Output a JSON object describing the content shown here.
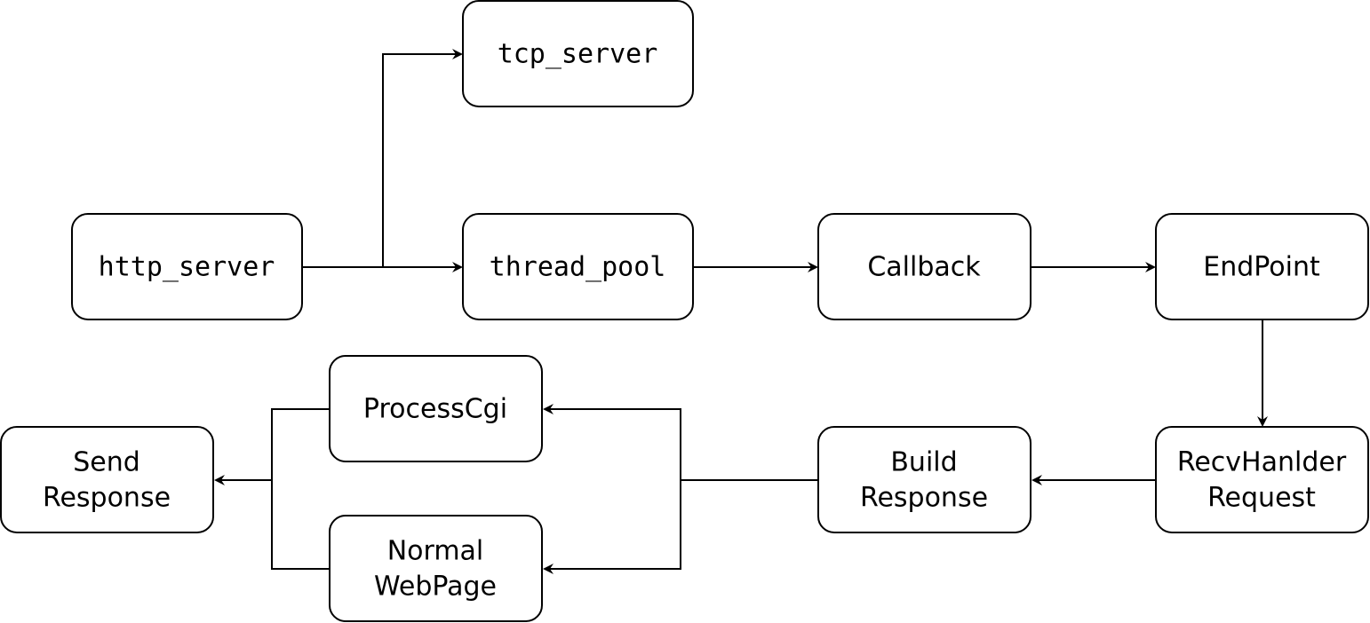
{
  "nodes": {
    "tcp_server": {
      "label": "tcp_server"
    },
    "http_server": {
      "label": "http_server"
    },
    "thread_pool": {
      "label": "thread_pool"
    },
    "callback": {
      "label": "Callback"
    },
    "endpoint": {
      "label": "EndPoint"
    },
    "recv_request": {
      "line1": "RecvHanlder",
      "line2": "Request"
    },
    "build_response": {
      "line1": "Build",
      "line2": "Response"
    },
    "process_cgi": {
      "label": "ProcessCgi"
    },
    "normal_webpage": {
      "line1": "Normal",
      "line2": "WebPage"
    },
    "send_response": {
      "line1": "Send",
      "line2": "Response"
    }
  },
  "edges": [
    {
      "from": "http_server",
      "to": "tcp_server"
    },
    {
      "from": "http_server",
      "to": "thread_pool"
    },
    {
      "from": "thread_pool",
      "to": "callback"
    },
    {
      "from": "callback",
      "to": "endpoint"
    },
    {
      "from": "endpoint",
      "to": "recv_request"
    },
    {
      "from": "recv_request",
      "to": "build_response"
    },
    {
      "from": "build_response",
      "to": "process_cgi"
    },
    {
      "from": "build_response",
      "to": "normal_webpage"
    },
    {
      "from": "process_cgi",
      "to": "send_response"
    },
    {
      "from": "normal_webpage",
      "to": "send_response"
    }
  ]
}
